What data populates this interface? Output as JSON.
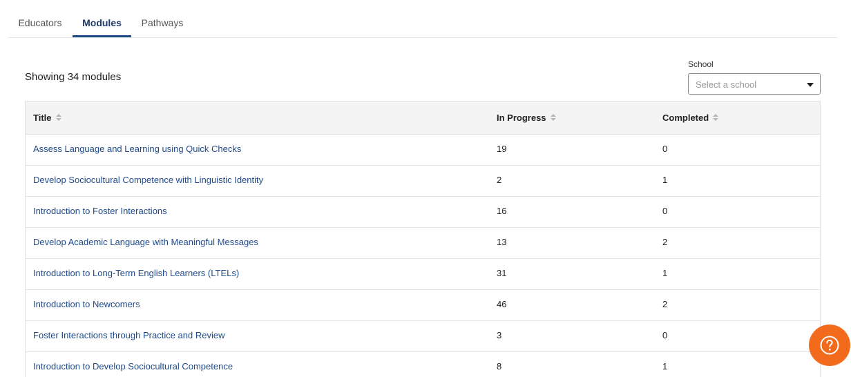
{
  "tabs": [
    {
      "label": "Educators",
      "active": false
    },
    {
      "label": "Modules",
      "active": true
    },
    {
      "label": "Pathways",
      "active": false
    }
  ],
  "summary": {
    "showing_text": "Showing 34 modules"
  },
  "filter": {
    "school_label": "School",
    "school_placeholder": "Select a school"
  },
  "table": {
    "columns": [
      "Title",
      "In Progress",
      "Completed"
    ],
    "rows": [
      {
        "title": "Assess Language and Learning using Quick Checks",
        "in_progress": "19",
        "completed": "0"
      },
      {
        "title": "Develop Sociocultural Competence with Linguistic Identity",
        "in_progress": "2",
        "completed": "1"
      },
      {
        "title": "Introduction to Foster Interactions",
        "in_progress": "16",
        "completed": "0"
      },
      {
        "title": "Develop Academic Language with Meaningful Messages",
        "in_progress": "13",
        "completed": "2"
      },
      {
        "title": "Introduction to Long-Term English Learners (LTELs)",
        "in_progress": "31",
        "completed": "1"
      },
      {
        "title": "Introduction to Newcomers",
        "in_progress": "46",
        "completed": "2"
      },
      {
        "title": "Foster Interactions through Practice and Review",
        "in_progress": "3",
        "completed": "0"
      },
      {
        "title": "Introduction to Develop Sociocultural Competence",
        "in_progress": "8",
        "completed": "1"
      }
    ]
  },
  "icons": {
    "sort": "sort-icon",
    "dropdown": "chevron-down-icon",
    "help": "help-icon"
  },
  "colors": {
    "accent": "#1f4a8a",
    "help_button": "#f26b1d",
    "header_bg": "#f4f4f4"
  }
}
